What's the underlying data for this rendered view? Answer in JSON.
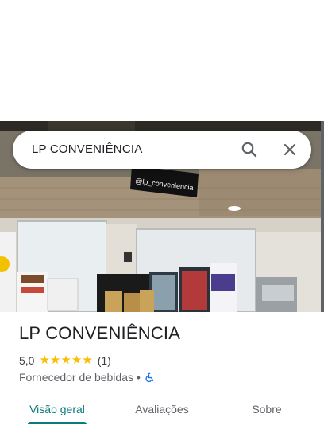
{
  "search": {
    "query": "LP CONVENIÊNCIA"
  },
  "photo": {
    "store_sign": "@lp_conveniencia"
  },
  "place": {
    "name": "LP CONVENIÊNCIA",
    "rating": "5,0",
    "review_count": "(1)",
    "category": "Fornecedor de bebidas",
    "separator": "•",
    "stars": 5
  },
  "tabs": [
    {
      "label": "Visão geral",
      "active": true
    },
    {
      "label": "Avaliações",
      "active": false
    },
    {
      "label": "Sobre",
      "active": false
    }
  ],
  "colors": {
    "accent": "#0b7a7a",
    "star": "#fbbc04",
    "accessibility": "#1a73e8"
  },
  "icons": {
    "search": "search-icon",
    "close": "close-icon",
    "accessibility": "wheelchair-icon",
    "star": "star-icon"
  }
}
